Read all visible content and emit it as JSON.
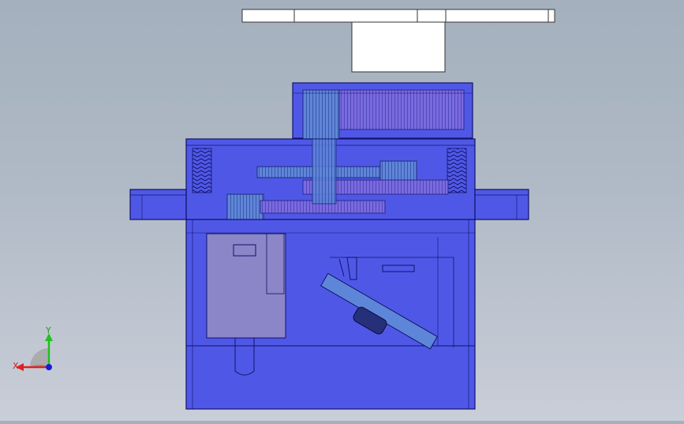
{
  "viewport": {
    "description_name": "cad-3d-viewport",
    "background_top": "#a4b0bd",
    "background_bottom": "#c9ced8"
  },
  "model": {
    "body_color": "#4f58e6",
    "edge_color": "#12126a",
    "gear_color": "#7a6ae0",
    "spline_color": "#6fa3d8",
    "motor_color": "#8a86c8",
    "horn_color": "#ffffff"
  },
  "triad": {
    "x_label": "X",
    "y_label": "Y",
    "x_color": "#e02020",
    "y_color": "#20c020",
    "z_color": "#1a1adc"
  }
}
